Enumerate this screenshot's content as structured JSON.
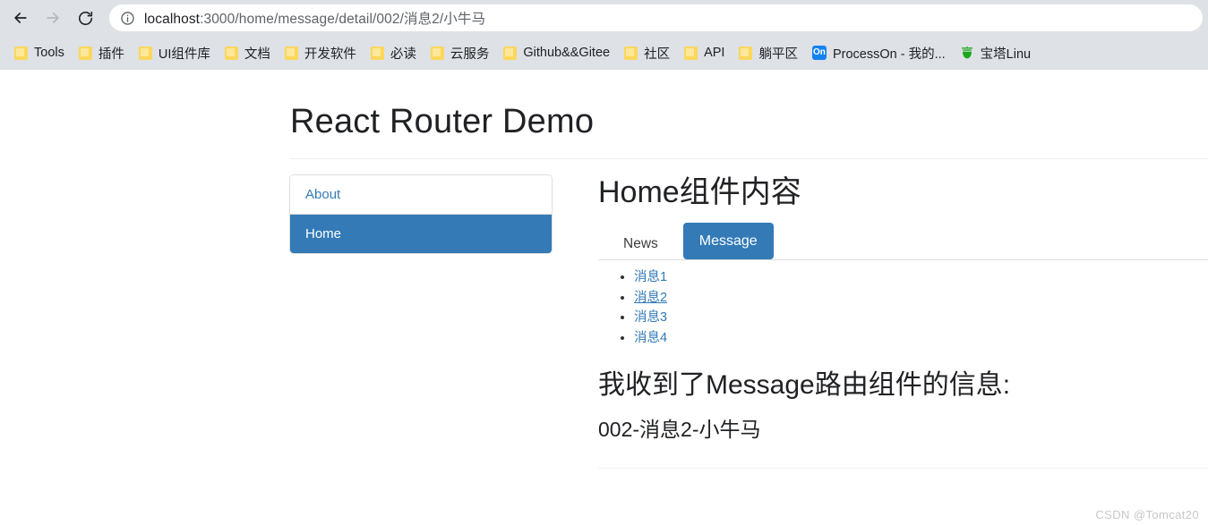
{
  "browser": {
    "nav": {
      "back_label": "Back",
      "forward_label": "Forward",
      "reload_label": "Reload",
      "site_info_label": "View site information"
    },
    "omnibox": {
      "url_host": "localhost",
      "url_rest": ":3000/home/message/detail/002/消息2/小牛马",
      "full_url": "localhost:3000/home/message/detail/002/消息2/小牛马",
      "placeholder": "Search Google or type a URL"
    },
    "bookmarks": [
      {
        "label": "Tools",
        "icon": "folder-icon"
      },
      {
        "label": "插件",
        "icon": "folder-icon"
      },
      {
        "label": "UI组件库",
        "icon": "folder-icon"
      },
      {
        "label": "文档",
        "icon": "folder-icon"
      },
      {
        "label": "开发软件",
        "icon": "folder-icon"
      },
      {
        "label": "必读",
        "icon": "folder-icon"
      },
      {
        "label": "云服务",
        "icon": "folder-icon"
      },
      {
        "label": "Github&&Gitee",
        "icon": "folder-icon"
      },
      {
        "label": "社区",
        "icon": "folder-icon"
      },
      {
        "label": "API",
        "icon": "folder-icon"
      },
      {
        "label": "躺平区",
        "icon": "folder-icon"
      },
      {
        "label": "ProcessOn - 我的...",
        "icon": "processon-icon"
      },
      {
        "label": "宝塔Linu",
        "icon": "bt-panel-icon"
      }
    ]
  },
  "page": {
    "title": "React Router Demo",
    "sidebar": {
      "items": [
        {
          "label": "About",
          "active": false
        },
        {
          "label": "Home",
          "active": true
        }
      ]
    },
    "main": {
      "heading": "Home组件内容",
      "tabs": [
        {
          "label": "News",
          "active": false
        },
        {
          "label": "Message",
          "active": true
        }
      ],
      "messages": [
        {
          "label": "消息1",
          "visited": false
        },
        {
          "label": "消息2",
          "visited": true
        },
        {
          "label": "消息3",
          "visited": false
        },
        {
          "label": "消息4",
          "visited": false
        }
      ],
      "detail_heading": "我收到了Message路由组件的信息:",
      "detail_line": "002-消息2-小牛马"
    }
  },
  "watermark": "CSDN @Tomcat20",
  "colors": {
    "primary": "#337ab7",
    "chrome_bg": "#dee1e6",
    "link": "#337ab7",
    "folder": "#fbd75b",
    "processon": "#1482f0",
    "bt_panel": "#1aa81a"
  }
}
